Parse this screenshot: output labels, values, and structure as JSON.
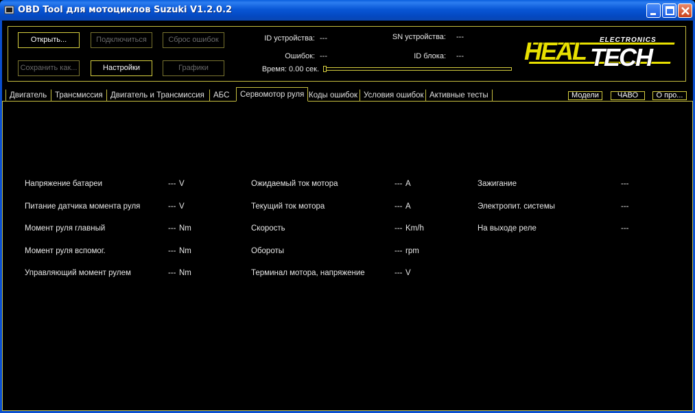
{
  "window": {
    "title": "OBD Tool для мотоциклов Suzuki V1.2.0.2"
  },
  "toolbar": {
    "open": "Открыть...",
    "connect": "Подключиться",
    "reset_errors": "Сброс ошибок",
    "save_as": "Сохранить как...",
    "settings": "Настройки",
    "graphs": "Графики"
  },
  "info": {
    "device_id_label": "ID устройства:",
    "device_id_value": "---",
    "device_sn_label": "SN устройства:",
    "device_sn_value": "---",
    "errors_label": "Ошибок:",
    "errors_value": "---",
    "block_id_label": "ID блока:",
    "block_id_value": "---",
    "time_label": "Время: 0.00 сек."
  },
  "logo": {
    "brand": "HEALTECH",
    "sub": "ELECTRONICS",
    "color_yellow": "#e8e000"
  },
  "tabs": [
    {
      "label": "Двигатель"
    },
    {
      "label": "Трансмиссия"
    },
    {
      "label": "Двигатель и Трансмиссия"
    },
    {
      "label": "АБС"
    },
    {
      "label": "Сервомотор руля"
    },
    {
      "label": "Коды ошибок"
    },
    {
      "label": "Условия ошибок"
    },
    {
      "label": "Активные тесты"
    }
  ],
  "right_buttons": {
    "models": "Модели",
    "faq": "ЧАВО",
    "about": "О про..."
  },
  "params": {
    "col1": [
      {
        "label": "Напряжение батареи",
        "value": "---",
        "unit": "V"
      },
      {
        "label": "Питание датчика момента руля",
        "value": "---",
        "unit": "V"
      },
      {
        "label": "Момент руля главный",
        "value": "---",
        "unit": "Nm"
      },
      {
        "label": "Момент руля вспомог.",
        "value": "---",
        "unit": "Nm"
      },
      {
        "label": "Управляющий момент рулем",
        "value": "---",
        "unit": "Nm"
      }
    ],
    "col2": [
      {
        "label": "Ожидаемый ток мотора",
        "value": "---",
        "unit": "A"
      },
      {
        "label": "Текущий ток мотора",
        "value": "---",
        "unit": "A"
      },
      {
        "label": "Скорость",
        "value": "---",
        "unit": "Km/h"
      },
      {
        "label": "Обороты",
        "value": "---",
        "unit": "rpm"
      },
      {
        "label": "Терминал мотора, напряжение",
        "value": "---",
        "unit": "V"
      }
    ],
    "col3": [
      {
        "label": "Зажигание",
        "value": "---"
      },
      {
        "label": "Электропит. системы",
        "value": "---"
      },
      {
        "label": "На выходе реле",
        "value": "---"
      }
    ]
  }
}
